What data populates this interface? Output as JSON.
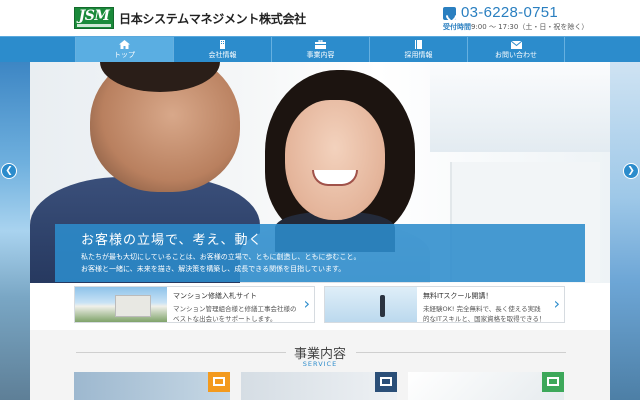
{
  "header": {
    "logo_text": "JSM",
    "company_name": "日本システムマネジメント株式会社",
    "phone": "03-6228-0751",
    "hours_label": "受付時間",
    "hours": "9:00 ～ 17:30（土・日・祝を除く）"
  },
  "nav": [
    {
      "label": "トップ",
      "icon": "home-icon"
    },
    {
      "label": "会社情報",
      "icon": "building-icon"
    },
    {
      "label": "事業内容",
      "icon": "briefcase-icon"
    },
    {
      "label": "採用情報",
      "icon": "book-icon"
    },
    {
      "label": "お問い合わせ",
      "icon": "mail-icon"
    }
  ],
  "hero": {
    "title": "お客様の立場で、考え、動く",
    "text_line1": "私たちが最も大切にしていることは、お客様の立場で、ともに創造し、ともに歩むこと。",
    "text_line2": "お客様と一緒に、未来を描き、解決策を構築し、成長できる関係を目指しています。"
  },
  "slider": {
    "prev_icon": "chevron-left-icon",
    "next_icon": "chevron-right-icon"
  },
  "banners": [
    {
      "title": "マンション修繕入札サイト",
      "line1": "マンション管理組合様と修繕工事会社様の",
      "line2": "ベストな出会いをサポートします。"
    },
    {
      "title": "無料ITスクール開講！",
      "line1": "未経験OK! 完全無料で、長く使える実践",
      "line2": "的なITスキルと、国家資格を取得できる！"
    }
  ],
  "services": {
    "title": "事業内容",
    "subtitle": "SERVICE",
    "cards": [
      {
        "icon": "monitor-icon",
        "color": "#f39a1e"
      },
      {
        "icon": "server-icon",
        "color": "#2b4f78"
      },
      {
        "icon": "chart-icon",
        "color": "#3da85a"
      }
    ]
  },
  "colors": {
    "brand_blue": "#2c8ccc",
    "logo_green": "#1a8a3a"
  }
}
